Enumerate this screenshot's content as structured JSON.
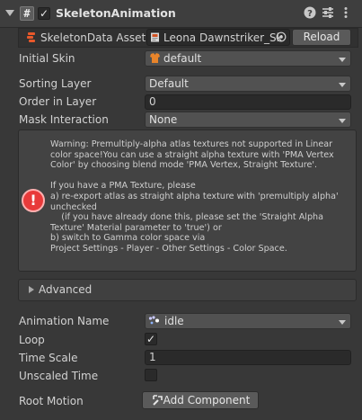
{
  "component": {
    "title": "SkeletonAnimation",
    "enabled": true,
    "header_icons": [
      "help-icon",
      "presets-icon",
      "context-menu-icon"
    ]
  },
  "skeleton_data": {
    "label": "SkeletonData Asset",
    "asset_name": "Leona Dawnstriker_Sk",
    "reload_label": "Reload"
  },
  "fields": {
    "initial_skin": {
      "label": "Initial Skin",
      "value": "default"
    },
    "sorting_layer": {
      "label": "Sorting Layer",
      "value": "Default"
    },
    "order_in_layer": {
      "label": "Order in Layer",
      "value": "0"
    },
    "mask_interaction": {
      "label": "Mask Interaction",
      "value": "None"
    }
  },
  "warning": {
    "text": "Warning: Premultiply-alpha atlas textures not supported in Linear color space!You can use a straight alpha texture with 'PMA Vertex Color' by choosing blend mode 'PMA Vertex, Straight Texture'.\n\nIf you have a PMA Texture, please\na) re-export atlas as straight alpha texture with 'premultiply alpha' unchecked\n    (if you have already done this, please set the 'Straight Alpha Texture' Material parameter to 'true') or\nb) switch to Gamma color space via\nProject Settings - Player - Other Settings - Color Space.",
    "icon": "error-icon"
  },
  "advanced": {
    "label": "Advanced"
  },
  "animation": {
    "animation_name": {
      "label": "Animation Name",
      "value": "idle"
    },
    "loop": {
      "label": "Loop",
      "checked": true
    },
    "time_scale": {
      "label": "Time Scale",
      "value": "1"
    },
    "unscaled_time": {
      "label": "Unscaled Time",
      "checked": false
    },
    "root_motion": {
      "label": "Root Motion",
      "button": "Add Component"
    }
  },
  "colors": {
    "background": "#383838",
    "field": "#2a2a2a",
    "dropdown": "#515151",
    "error": "#e83a3a"
  }
}
